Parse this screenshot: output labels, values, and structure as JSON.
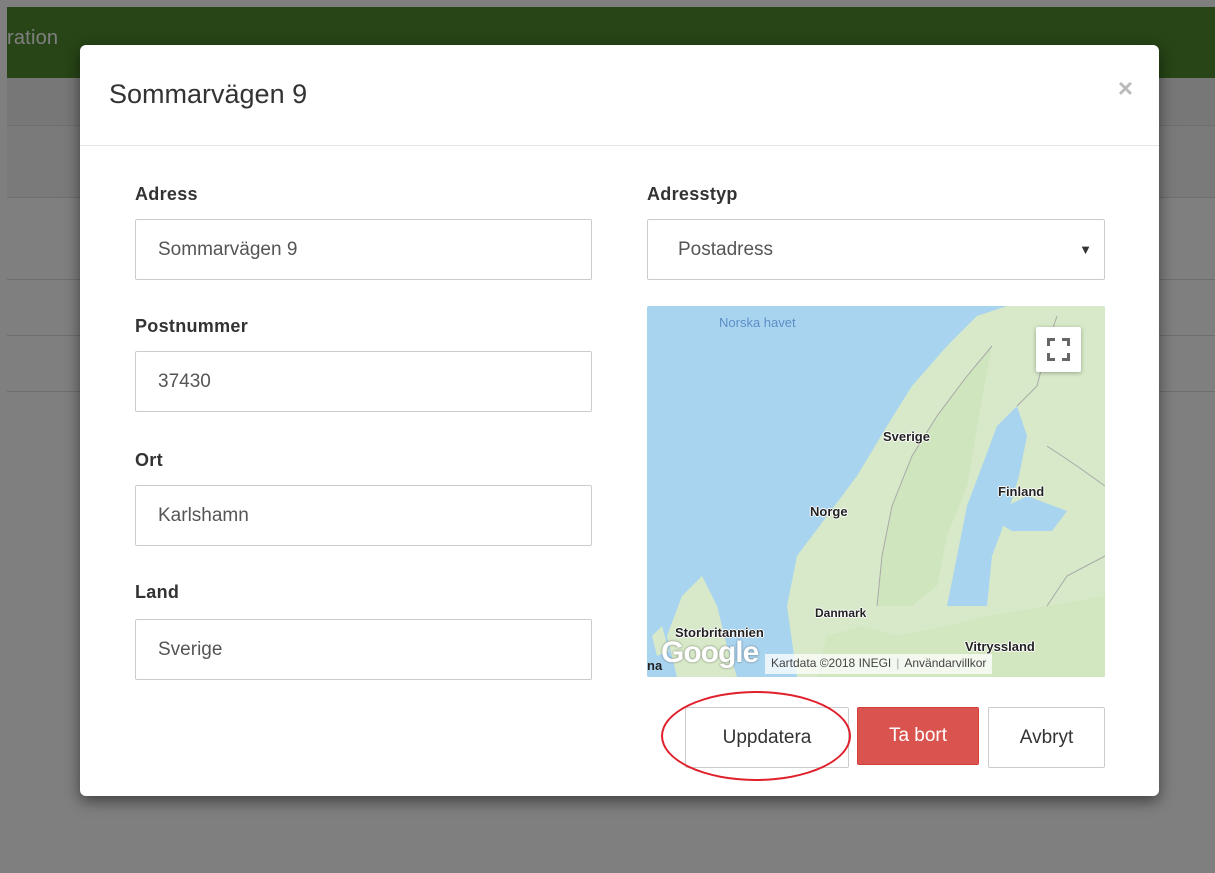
{
  "background": {
    "header_title_fragment": "ration",
    "header_color": "#4e8a2c"
  },
  "modal": {
    "title": "Sommarvägen 9",
    "close_glyph": "×"
  },
  "form": {
    "address": {
      "label": "Adress",
      "value": "Sommarvägen 9"
    },
    "postal_code": {
      "label": "Postnummer",
      "value": "37430"
    },
    "city": {
      "label": "Ort",
      "value": "Karlshamn"
    },
    "country": {
      "label": "Land",
      "value": "Sverige"
    },
    "address_type": {
      "label": "Adresstyp",
      "selected": "Postadress"
    }
  },
  "map": {
    "labels": {
      "sea": "Norska havet",
      "sweden": "Sverige",
      "finland": "Finland",
      "norway": "Norge",
      "denmark": "Danmark",
      "uk": "Storbritannien",
      "russia": "Vitryssland",
      "edge": "na"
    },
    "logo": "Google",
    "attribution": "Kartdata ©2018 INEGI",
    "terms": "Användarvillkor",
    "fullscreen_icon": "fullscreen-icon"
  },
  "buttons": {
    "update": "Uppdatera",
    "delete": "Ta bort",
    "cancel": "Avbryt"
  },
  "colors": {
    "danger": "#d9534f",
    "annotation_ring": "#e0202a"
  }
}
